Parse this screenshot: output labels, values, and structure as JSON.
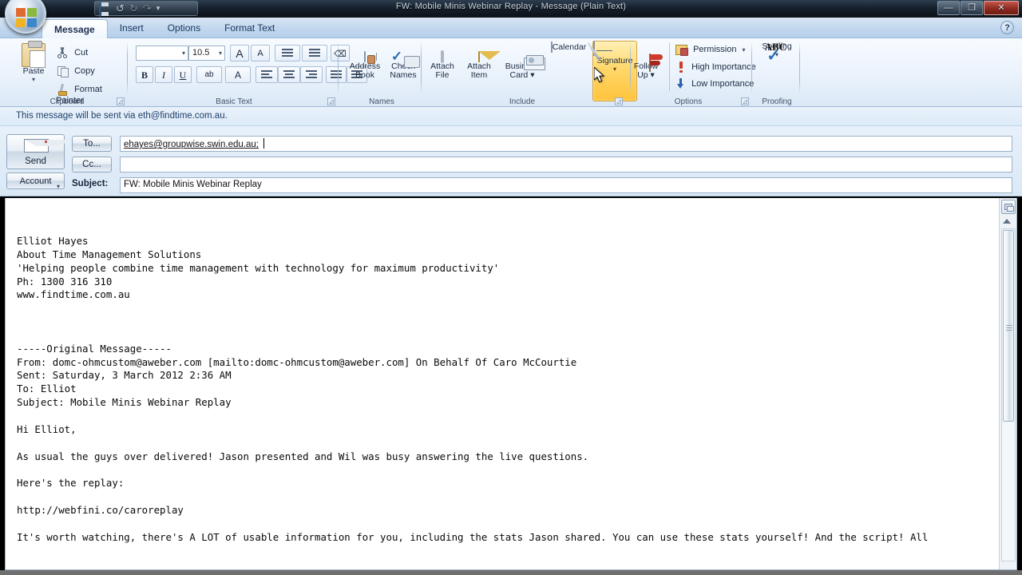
{
  "window": {
    "title": "FW: Mobile Minis Webinar Replay - Message (Plain Text)",
    "minimize_label": "—",
    "maximize_label": "❐",
    "close_label": "✕",
    "help_label": "?"
  },
  "quick_access": {
    "save_label": "Save",
    "undo_label": "Undo",
    "redo_label": "Redo",
    "customize_label": "▾"
  },
  "tabs": [
    {
      "label": "Message",
      "active": true
    },
    {
      "label": "Insert",
      "active": false
    },
    {
      "label": "Options",
      "active": false
    },
    {
      "label": "Format Text",
      "active": false
    }
  ],
  "ribbon": {
    "clipboard": {
      "group_label": "Clipboard",
      "paste_label": "Paste",
      "paste_dropdown": "▾",
      "cut_label": "Cut",
      "copy_label": "Copy",
      "format_painter_label": "Format Painter"
    },
    "basic_text": {
      "group_label": "Basic Text",
      "font_name": "",
      "font_size": "10.5",
      "grow_font_label": "A",
      "shrink_font_label": "A",
      "bold_label": "B",
      "italic_label": "I",
      "underline_label": "U",
      "highlight_label": "ab",
      "font_color_label": "A",
      "bullets_label": "Bullets",
      "numbering_label": "Numbering",
      "clear_formatting_label": "Clear Formatting",
      "align_left_label": "Align Left",
      "align_center_label": "Center",
      "align_right_label": "Align Right",
      "decrease_indent_label": "Decrease Indent",
      "increase_indent_label": "Increase Indent"
    },
    "names": {
      "group_label": "Names",
      "address_book_label": "Address\nBook",
      "check_names_label": "Check\nNames"
    },
    "include": {
      "group_label": "Include",
      "attach_file_label": "Attach\nFile",
      "attach_item_label": "Attach\nItem",
      "business_card_label": "Business\nCard ▾",
      "calendar_label": "Calendar",
      "signature_label": "Signature",
      "signature_dropdown": "▾"
    },
    "options": {
      "group_label": "Options",
      "follow_up_label": "Follow\nUp ▾",
      "permission_label": "Permission",
      "permission_dropdown": "▾",
      "high_importance_label": "High Importance",
      "low_importance_label": "Low Importance"
    },
    "proofing": {
      "group_label": "Proofing",
      "spelling_label": "Spelling",
      "spelling_dropdown": "▾",
      "abc_label": "ABC"
    }
  },
  "compose": {
    "account_info": "This message will be sent via eth@findtime.com.au.",
    "send_label": "Send",
    "account_label": "Account",
    "account_dropdown": "▾",
    "to_button_label": "To...",
    "cc_button_label": "Cc...",
    "to_value": "ehayes@groupwise.swin.edu.au;",
    "cc_value": "",
    "subject_label": "Subject:",
    "subject_value": "FW: Mobile Minis Webinar Replay"
  },
  "body": {
    "text": "Elliot Hayes\nAbout Time Management Solutions\n'Helping people combine time management with technology for maximum productivity'\nPh: 1300 316 310\nwww.findtime.com.au\n\n\n\n-----Original Message-----\nFrom: domc-ohmcustom@aweber.com [mailto:domc-ohmcustom@aweber.com] On Behalf Of Caro McCourtie\nSent: Saturday, 3 March 2012 2:36 AM\nTo: Elliot\nSubject: Mobile Minis Webinar Replay\n\nHi Elliot,\n\nAs usual the guys over delivered! Jason presented and Wil was busy answering the live questions.\n\nHere's the replay:\n\nhttp://webfini.co/caroreplay\n\nIt's worth watching, there's A LOT of usable information for you, including the stats Jason shared. You can use these stats yourself! And the script! All"
  },
  "colors": {
    "accent": "#ffc33c",
    "title_bar": "#16202c",
    "ribbon_bg": "#eaf2fb",
    "close_button": "#8e2a20"
  }
}
